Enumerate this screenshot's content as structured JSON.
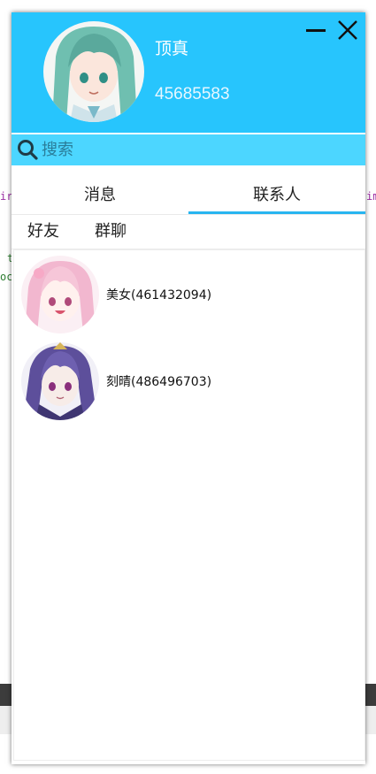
{
  "profile": {
    "nickname": "顶真",
    "account": "45685583"
  },
  "search": {
    "placeholder": "搜索"
  },
  "tabs": [
    {
      "label": "消息"
    },
    {
      "label": "联系人"
    }
  ],
  "subtabs": [
    {
      "label": "好友"
    },
    {
      "label": "群聊"
    }
  ],
  "contacts": [
    {
      "name": "美女",
      "id_text": "(461432094)",
      "display": "美女(461432094)"
    },
    {
      "name": "刻晴",
      "id_text": "(486496703)",
      "display": "刻晴(486496703)"
    }
  ],
  "background_code": {
    "fragment_left": "ir",
    "fragment_right": "im",
    "fragment_t": "t",
    "fragment_o": "oc"
  },
  "colors": {
    "header": "#27c5fd",
    "search": "#4cd6ff",
    "tab_underline": "#27b5f0"
  },
  "icons": {
    "minimize": "minimize-icon",
    "close": "close-icon",
    "search": "search-icon"
  }
}
